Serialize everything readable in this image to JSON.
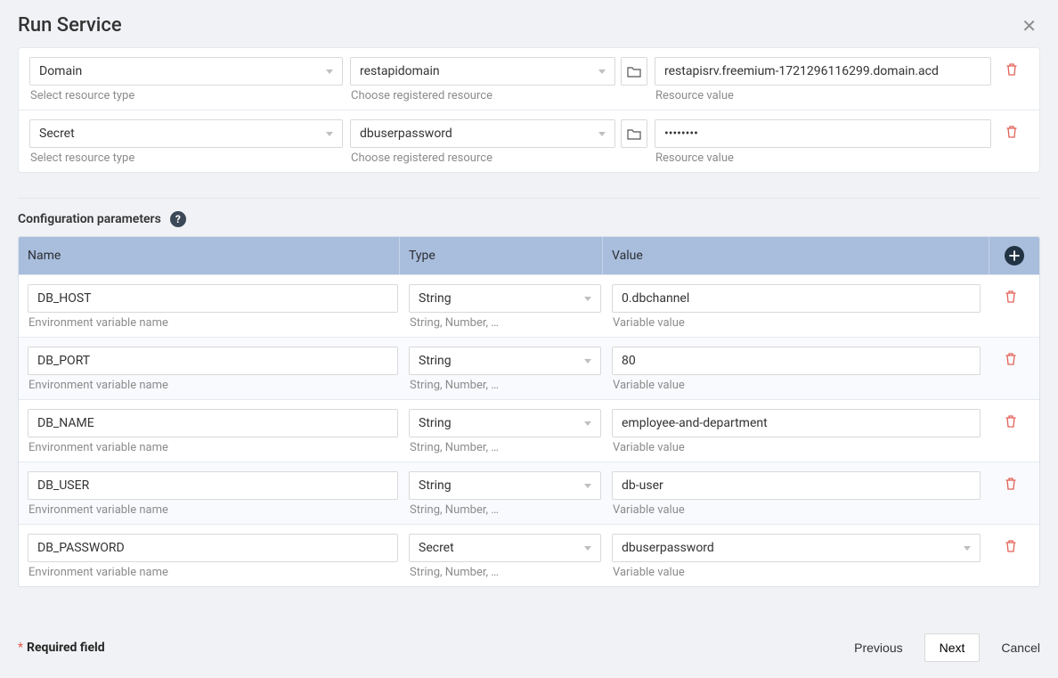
{
  "title": "Run Service",
  "resources": {
    "helpers": {
      "type": "Select resource type",
      "resource": "Choose registered resource",
      "value": "Resource value"
    },
    "rows": [
      {
        "type": "Domain",
        "resource": "restapidomain",
        "value": "restapisrv.freemium-1721296116299.domain.acd",
        "masked": false
      },
      {
        "type": "Secret",
        "resource": "dbuserpassword",
        "value": "••••••••",
        "masked": true
      }
    ]
  },
  "config": {
    "title": "Configuration parameters",
    "columns": {
      "name": "Name",
      "type": "Type",
      "value": "Value"
    },
    "helpers": {
      "name": "Environment variable name",
      "type": "String, Number, …",
      "value": "Variable value"
    },
    "rows": [
      {
        "name": "DB_HOST",
        "type": "String",
        "value": "0.dbchannel",
        "value_is_select": false
      },
      {
        "name": "DB_PORT",
        "type": "String",
        "value": "80",
        "value_is_select": false
      },
      {
        "name": "DB_NAME",
        "type": "String",
        "value": "employee-and-department",
        "value_is_select": false
      },
      {
        "name": "DB_USER",
        "type": "String",
        "value": "db-user",
        "value_is_select": false
      },
      {
        "name": "DB_PASSWORD",
        "type": "Secret",
        "value": "dbuserpassword",
        "value_is_select": true
      }
    ]
  },
  "footer": {
    "required": "Required field",
    "previous": "Previous",
    "next": "Next",
    "cancel": "Cancel"
  }
}
